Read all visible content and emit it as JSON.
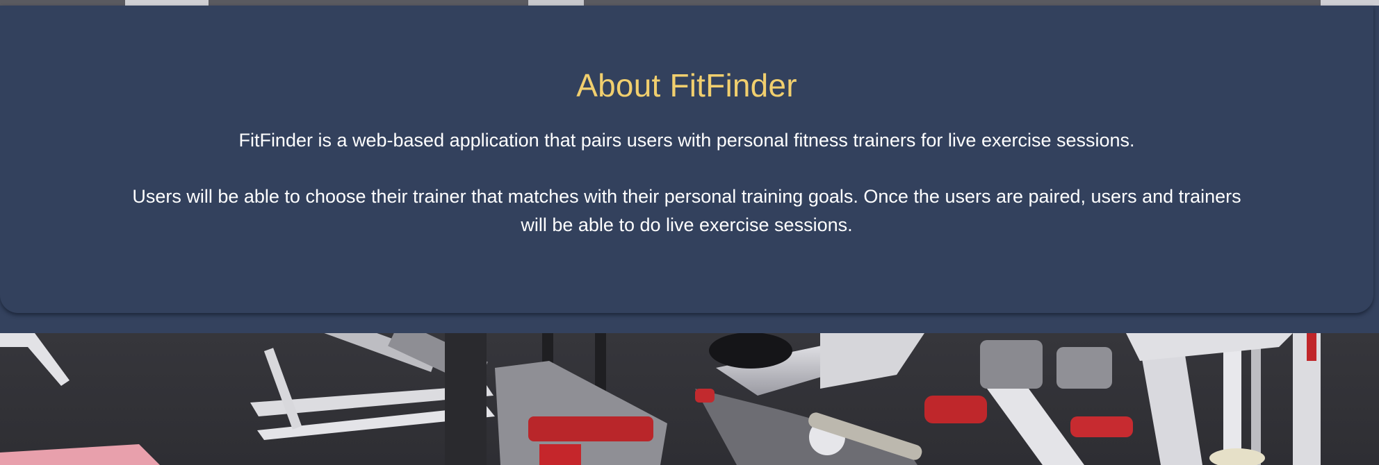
{
  "about": {
    "title": "About FitFinder",
    "paragraphs": [
      "FitFinder is a web-based application that pairs users with personal fitness trainers for live exercise sessions.",
      "Users will be able to choose their trainer that matches with their personal training goals. Once the users are paired, users and trainers will be able to do live exercise sessions."
    ]
  },
  "colors": {
    "band_background": "#34425e",
    "title_color": "#f1cf6e",
    "text_color": "#ffffff"
  },
  "background_image": {
    "subject": "gym-equipment-photo"
  }
}
